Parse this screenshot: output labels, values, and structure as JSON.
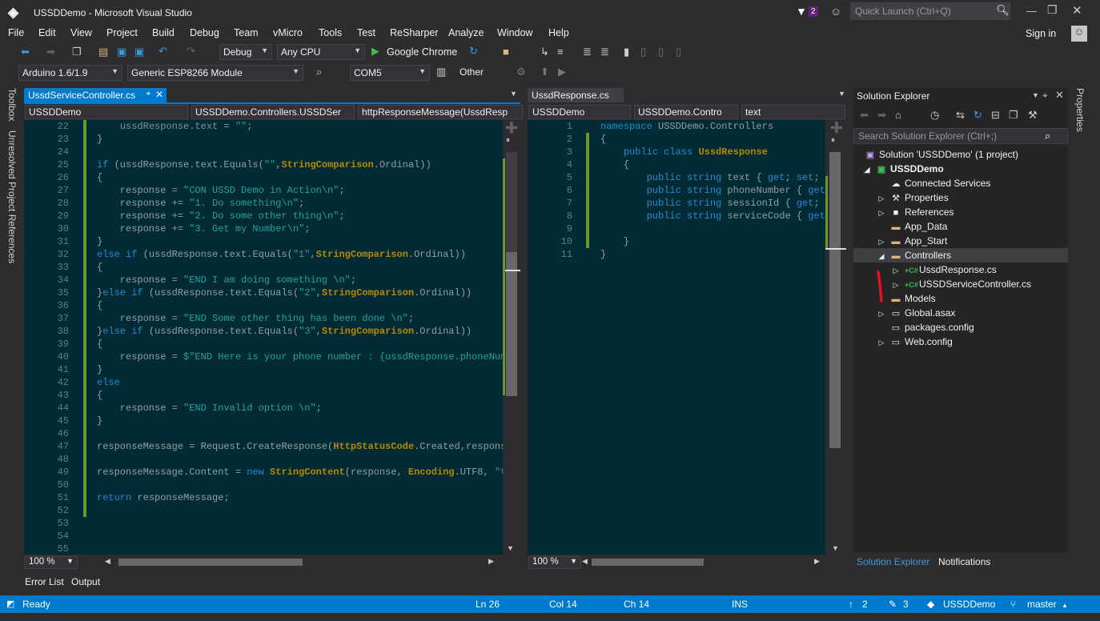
{
  "window": {
    "title": "USSDDemo - Microsoft Visual Studio",
    "notifications": "2",
    "quick_launch_placeholder": "Quick Launch (Ctrl+Q)",
    "sign_in": "Sign in"
  },
  "menu": [
    "File",
    "Edit",
    "View",
    "Project",
    "Build",
    "Debug",
    "Team",
    "vMicro",
    "Tools",
    "Test",
    "ReSharper",
    "Analyze",
    "Window",
    "Help"
  ],
  "toolbar1": {
    "config": "Debug",
    "platform": "Any CPU",
    "run": "Google Chrome"
  },
  "toolbar2": {
    "board_version": "Arduino 1.6/1.9",
    "board": "Generic ESP8266 Module",
    "port": "COM5",
    "other": "Other"
  },
  "left_vertical_tabs": [
    "Toolbox",
    "Unresolved Project References"
  ],
  "right_vertical_tab": "Properties",
  "editor1": {
    "tab": "UssdServiceController.cs",
    "nav": [
      "USSDDemo",
      "USSDDemo.Controllers.USSDSer",
      "httpResponseMessage(UssdResp"
    ],
    "zoom": "100 %",
    "lines": [
      "22",
      "23",
      "24",
      "25",
      "26",
      "27",
      "28",
      "29",
      "30",
      "31",
      "32",
      "33",
      "34",
      "35",
      "36",
      "37",
      "38",
      "39",
      "40",
      "41",
      "42",
      "43",
      "44",
      "45",
      "46",
      "47",
      "48",
      "49",
      "50",
      "51",
      "52",
      "53",
      "54",
      "55"
    ]
  },
  "editor2": {
    "tab": "UssdResponse.cs",
    "nav": [
      "USSDDemo",
      "USSDDemo.Contro",
      "text"
    ],
    "zoom": "100 %",
    "lines": [
      "1",
      "2",
      "3",
      "4",
      "5",
      "6",
      "7",
      "8",
      "9",
      "10",
      "11"
    ]
  },
  "solution_explorer": {
    "title": "Solution Explorer",
    "search_placeholder": "Search Solution Explorer (Ctrl+;)",
    "items": [
      {
        "label": "Solution 'USSDDemo' (1 project)"
      },
      {
        "label": "USSDDemo"
      },
      {
        "label": "Connected Services"
      },
      {
        "label": "Properties"
      },
      {
        "label": "References"
      },
      {
        "label": "App_Data"
      },
      {
        "label": "App_Start"
      },
      {
        "label": "Controllers"
      },
      {
        "label": "UssdResponse.cs"
      },
      {
        "label": "USSDServiceController.cs"
      },
      {
        "label": "Models"
      },
      {
        "label": "Global.asax"
      },
      {
        "label": "packages.config"
      },
      {
        "label": "Web.config"
      }
    ],
    "tabs": [
      "Solution Explorer",
      "Notifications"
    ]
  },
  "bottom_tabs": [
    "Error List",
    "Output"
  ],
  "status": {
    "ready": "Ready",
    "ln": "Ln 26",
    "col": "Col 14",
    "ch": "Ch 14",
    "ins": "INS",
    "up": "2",
    "edits": "3",
    "repo": "USSDDemo",
    "branch": "master"
  },
  "colors": {
    "accent": "#007acc",
    "editor_bg": "#022b36",
    "keyword": "#268bd2",
    "string": "#2aa198",
    "type": "#b58900"
  }
}
